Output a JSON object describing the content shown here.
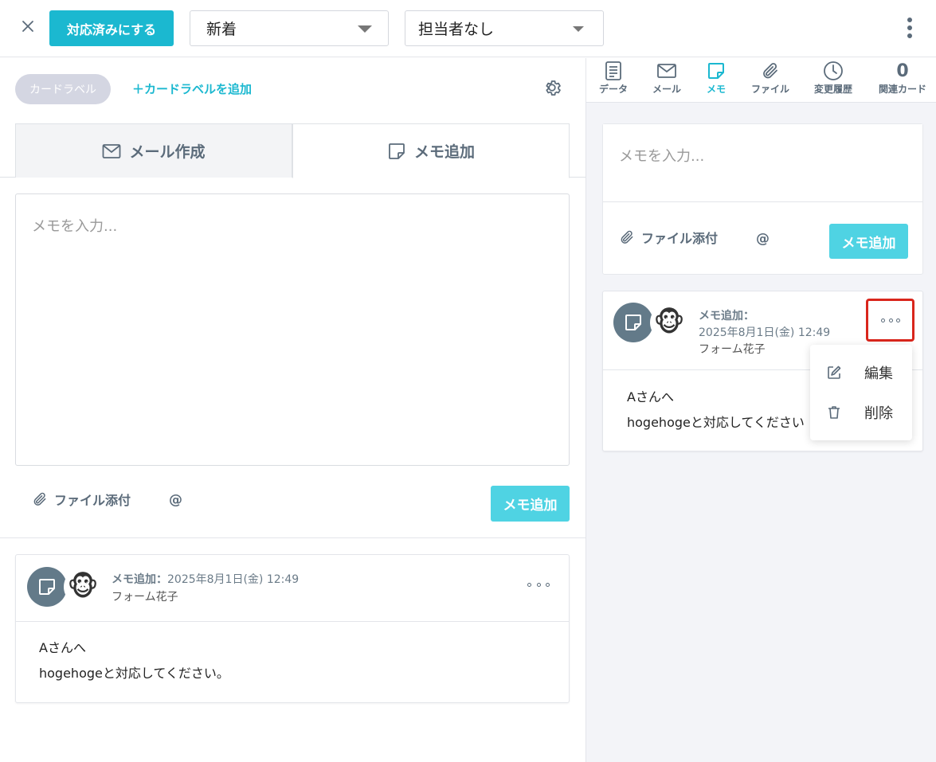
{
  "topbar": {
    "resolve_label": "対応済みにする",
    "status_value": "新着",
    "assignee_value": "担当者なし"
  },
  "left": {
    "card_label": "カードラベル",
    "add_label_link": "＋カードラベルを追加",
    "tabs": {
      "mail": "メール作成",
      "memo": "メモ追加"
    },
    "memo_placeholder": "メモを入力...",
    "file_attach": "ファイル添付",
    "mention": "@",
    "add_memo": "メモ追加",
    "memo_item": {
      "action": "メモ追加：",
      "timestamp": "2025年8月1日(金) 12:49",
      "author": "フォーム花子",
      "body_line1": "Aさんへ",
      "body_line2": "hogehogeと対応してください。"
    }
  },
  "right": {
    "tabs": [
      {
        "label": "データ",
        "icon": "document-icon"
      },
      {
        "label": "メール",
        "icon": "envelope-icon"
      },
      {
        "label": "メモ",
        "icon": "sticky-note-icon"
      },
      {
        "label": "ファイル",
        "icon": "paperclip-icon"
      },
      {
        "label": "変更履歴",
        "icon": "clock-icon"
      },
      {
        "label": "関連カード",
        "count": "0"
      }
    ],
    "memo_placeholder": "メモを入力...",
    "file_attach": "ファイル添付",
    "mention": "@",
    "add_memo": "メモ追加",
    "memo_item": {
      "action": "メモ追加：",
      "timestamp": "2025年8月1日(金) 12:49",
      "author": "フォーム花子",
      "body_line1": "Aさんへ",
      "body_line2": "hogehogeと対応してください"
    },
    "menu": {
      "edit": "編集",
      "delete": "削除"
    }
  },
  "colors": {
    "accent": "#1bb8d0",
    "button_light": "#4fd3e3",
    "highlight": "#d9261c",
    "avatar_bg": "#637a89"
  },
  "avatar_emoji": "🐵"
}
